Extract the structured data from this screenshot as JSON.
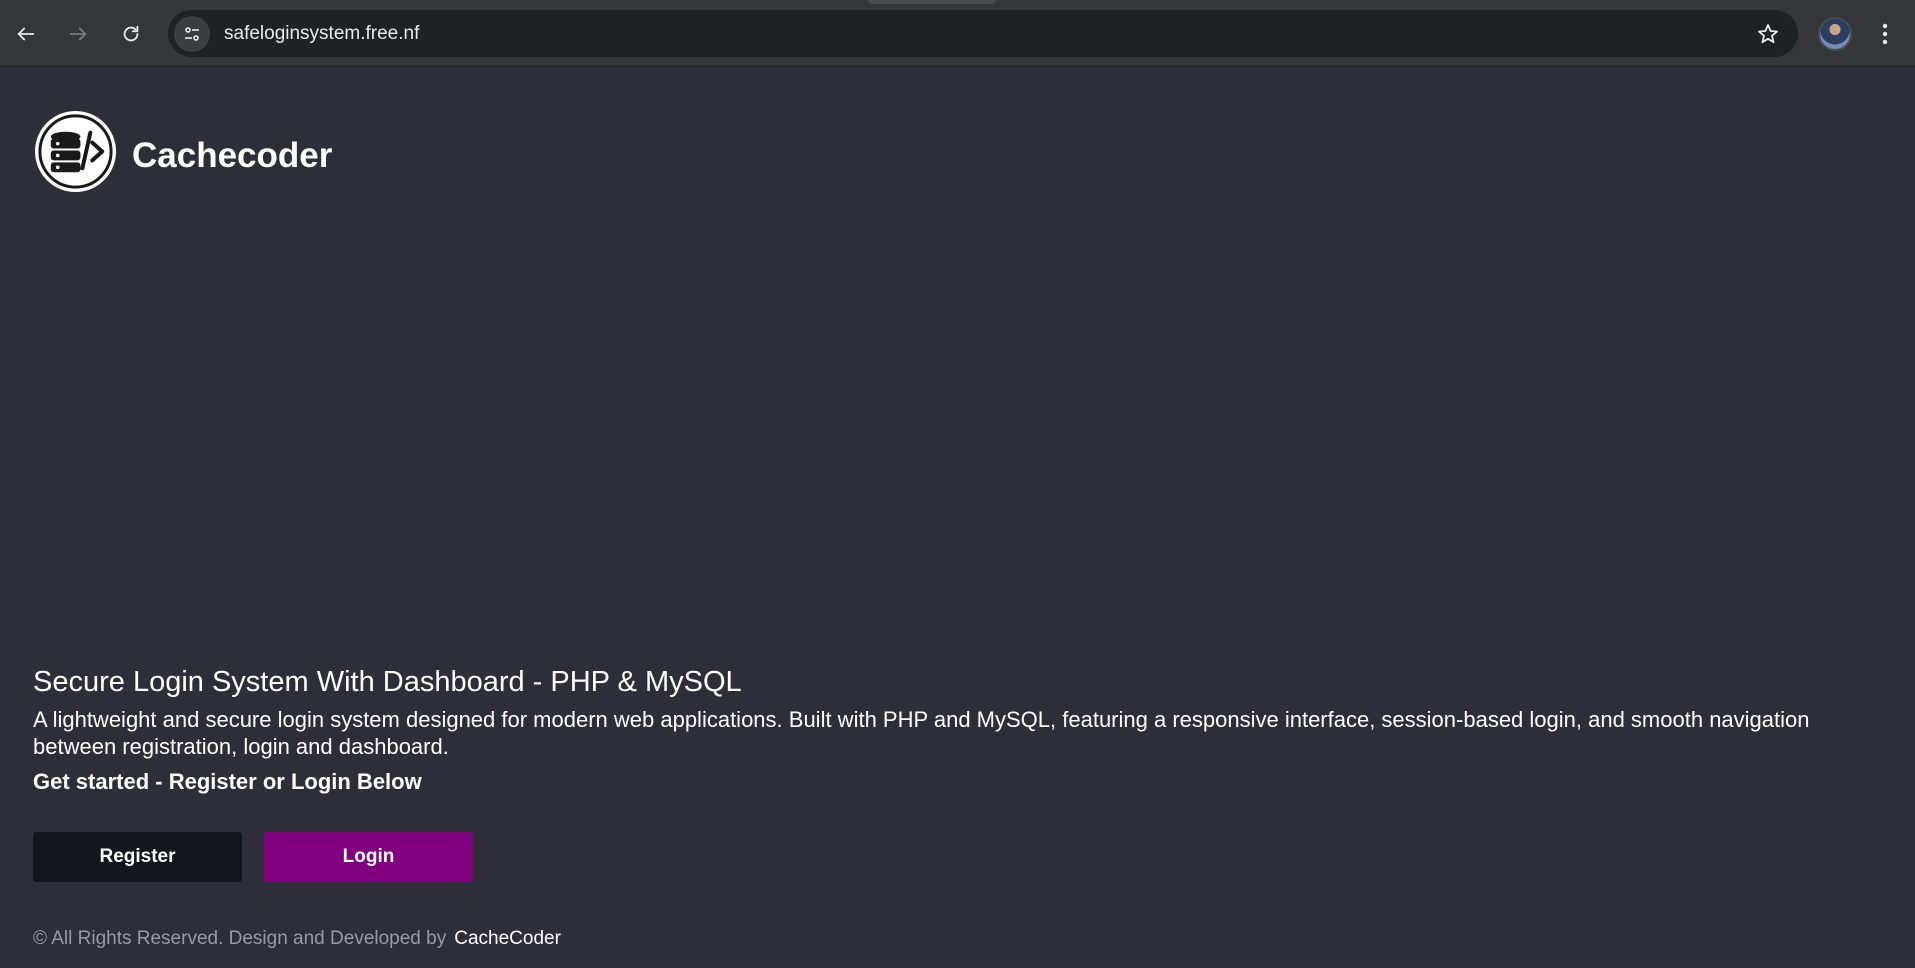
{
  "browser": {
    "url": "safeloginsystem.free.nf",
    "back_icon": "arrow-left-icon",
    "forward_icon": "arrow-right-icon",
    "reload_icon": "reload-icon",
    "site_info_icon": "tune-icon",
    "bookmark_icon": "star-icon",
    "menu_icon": "kebab-menu-icon"
  },
  "brand": {
    "name": "Cachecoder",
    "logo_icon": "database-code-icon"
  },
  "hero": {
    "title": "Secure Login System With Dashboard - PHP & MySQL",
    "description": "A lightweight and secure login system designed for modern web applications. Built with PHP and MySQL, featuring a responsive interface, session-based login, and smooth navigation between registration, login and dashboard.",
    "cta": "Get started - Register or Login Below"
  },
  "buttons": {
    "register_label": "Register",
    "login_label": "Login"
  },
  "footer": {
    "copyright": "© All Rights Reserved. Design and Developed by",
    "author": "CacheCoder"
  },
  "colors": {
    "page_bg": "#2e2e38",
    "register_bg": "#15151c",
    "login_bg": "#800080"
  }
}
